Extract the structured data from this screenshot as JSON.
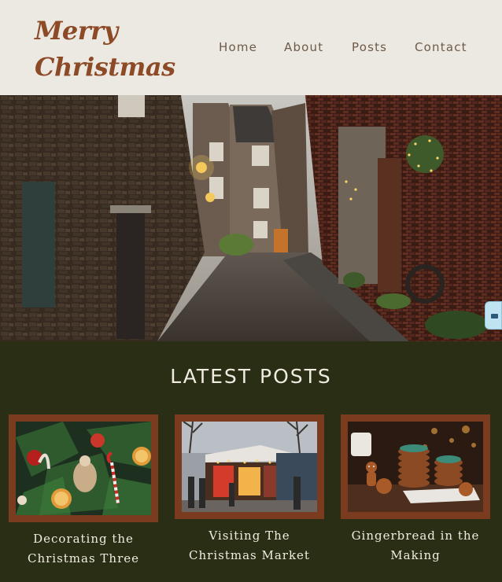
{
  "header": {
    "logo_line1": "Merry",
    "logo_line2": "Christmas",
    "nav": [
      {
        "label": "Home"
      },
      {
        "label": "About"
      },
      {
        "label": "Posts"
      },
      {
        "label": "Contact"
      }
    ]
  },
  "hero": {
    "image": "snowy-old-town-street-photo"
  },
  "latest": {
    "title": "LATEST POSTS",
    "posts": [
      {
        "title_line1": "Decorating the",
        "title_line2": "Christmas Three",
        "image": "christmas-tree-ornaments-photo"
      },
      {
        "title_line1": "Visiting The",
        "title_line2": "Christmas Market",
        "image": "christmas-market-stalls-photo"
      },
      {
        "title_line1": "Gingerbread in the",
        "title_line2": "Making",
        "image": "gingerbread-cookies-photo"
      }
    ]
  },
  "colors": {
    "header_bg": "#ece8e2",
    "logo": "#8c4a26",
    "page_bg": "#2a2e14",
    "card_frame": "#7a3b1e",
    "text_light": "#f1ece2"
  }
}
